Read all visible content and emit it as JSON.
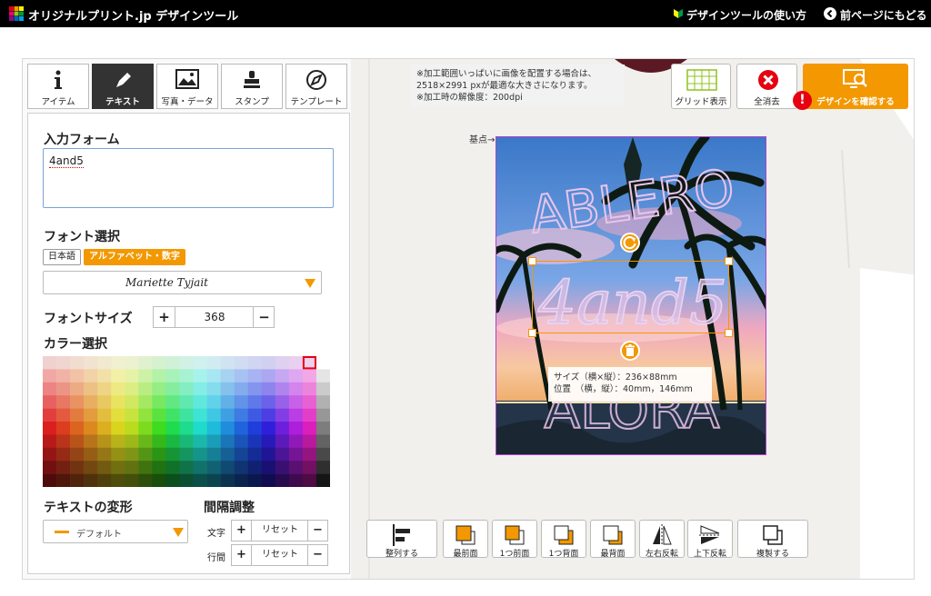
{
  "header": {
    "logo_text": "オリジナルプリント.jp デザインツール",
    "help_link": "デザインツールの使い方",
    "back_link": "前ページにもどる"
  },
  "tabs": [
    {
      "label": "アイテム",
      "icon": "info-icon"
    },
    {
      "label": "テキスト",
      "icon": "pen-icon",
      "active": true
    },
    {
      "label": "写真・データ",
      "icon": "image-icon"
    },
    {
      "label": "スタンプ",
      "icon": "stamp-icon"
    },
    {
      "label": "テンプレート",
      "icon": "template-icon"
    }
  ],
  "text_panel": {
    "input_title": "入力フォーム",
    "input_value": "4and5",
    "font_title": "フォント選択",
    "font_lang_options": [
      "日本語",
      "アルファベット・数字"
    ],
    "font_lang_selected": "アルファベット・数字",
    "font_selected": "Mariette Tyjait",
    "size_title": "フォントサイズ",
    "size_value": "368",
    "color_title": "カラー選択",
    "transform_title": "テキストの変形",
    "transform_value": "デフォルト",
    "spacing_title": "間隔調整",
    "spacing_char_label": "文字",
    "spacing_line_label": "行間",
    "reset_label": "リセット"
  },
  "canvas": {
    "note_lines": [
      "※加工範囲いっぱいに画像を配置する場合は、",
      "2518×2991 pxが最適な大きさになります。",
      "※加工時の解像度：200dpi"
    ],
    "origin_label": "基点→",
    "design_top_text": "ABLERO",
    "design_bottom_text": "ALORA",
    "design_text": "4and5",
    "size_tip_line1": "サイズ（横×縦）：236×88mm",
    "size_tip_line2": "位置　（横，縦）：40mm，146mm"
  },
  "top_buttons": {
    "grid": "グリッド表示",
    "clear": "全消去",
    "confirm": "デザインを確認する"
  },
  "bottom_buttons": [
    "整列する",
    "最前面",
    "1つ前面",
    "1つ背面",
    "最背面",
    "左右反転",
    "上下反転",
    "複製する"
  ],
  "colors": {
    "accent": "#f39800",
    "alert": "#e60012",
    "selection": "#b040d0"
  }
}
